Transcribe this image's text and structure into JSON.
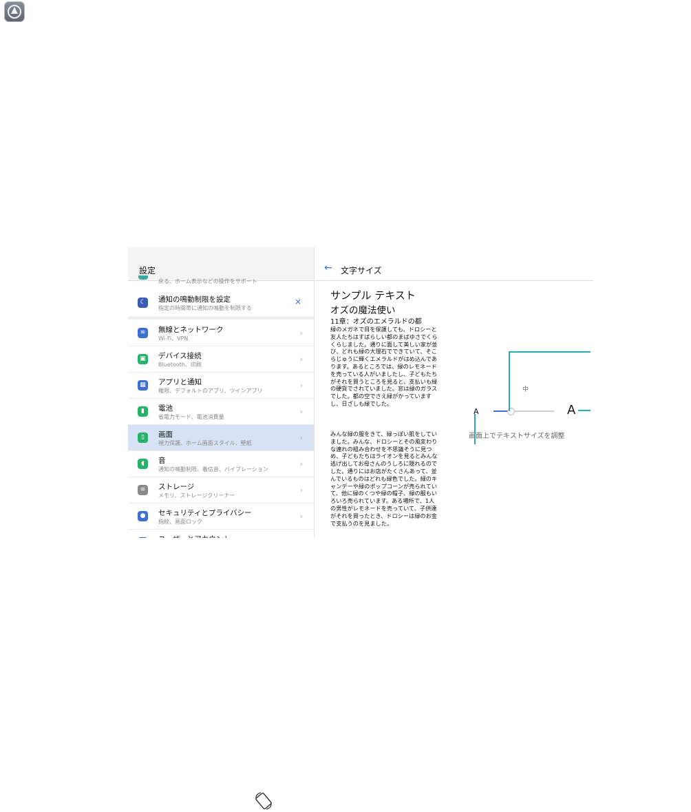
{
  "left_pane": {
    "title": "設定",
    "partial_top_subtitle": "戻る、ホーム表示などの操作をサポート",
    "dnd_suggestion": {
      "title": "通知の鳴動制限を設定",
      "subtitle": "指定の時間帯に通知の鳴動を制限する",
      "close": "×"
    },
    "items": [
      {
        "title": "無線とネットワーク",
        "subtitle": "Wi-Fi、VPN",
        "icon": "wifi-icon",
        "color": "#3b6fd1"
      },
      {
        "title": "デバイス接続",
        "subtitle": "Bluetooth、印刷",
        "icon": "device-connection-icon",
        "color": "#27b26a"
      },
      {
        "title": "アプリと通知",
        "subtitle": "権限、デフォルトのアプリ、ツインアプリ",
        "icon": "apps-icon",
        "color": "#3b6fd1"
      },
      {
        "title": "電池",
        "subtitle": "省電力モード、電池消費量",
        "icon": "battery-icon",
        "color": "#27b26a"
      },
      {
        "title": "画面",
        "subtitle": "視力保護、ホーム画面スタイル、壁紙",
        "icon": "display-icon",
        "color": "#27b26a",
        "active": true
      },
      {
        "title": "音",
        "subtitle": "通知の鳴動制限、着信音、バイブレーション",
        "icon": "sound-icon",
        "color": "#27b26a"
      },
      {
        "title": "ストレージ",
        "subtitle": "メモリ、ストレージクリーナー",
        "icon": "storage-icon",
        "color": "#8a8a8a"
      },
      {
        "title": "セキュリティとプライバシー",
        "subtitle": "指紋、画面ロック",
        "icon": "security-icon",
        "color": "#3b6fd1"
      },
      {
        "title": "ユーザーとアカウント",
        "subtitle": "",
        "icon": "user-icon",
        "color": "#3b6fd1"
      }
    ],
    "chevron": "›"
  },
  "right_pane": {
    "back": "←",
    "title": "文字サイズ",
    "sample_heading": "サンプル テキスト",
    "book_title": "オズの魔法使い",
    "chapter": "11章：オズのエメラルドの都",
    "paragraph1": "緑のメガネで目を保護しても、ドロシーと友人たちはすばらしい都のまばゆさでくらくらしました。通りに面して美しい家が並び、どれも緑の大理石でできていて、そこらじゅうに輝くエメラルドがはめ込んであります。あるところでは、緑のレモネードを売っている人がいましたし、子どもたちがそれを買うところを見ると、支払いも緑の硬貨でされていました。窓は緑のガラスでした。都の空でさえ緑がかっていますし、日ざしも緑でした。",
    "paragraph2": "みんな緑の服をきて、緑っぽい肌をしていました。みんな、ドロシーとその風変わりな連れの組み合わせを不思議そうに見つめ、子どもたちはライオンを見るとみんな逃げ出してお母さんのうしろに隠れるのでした。通りにはお店がたくさんあって、並んでいるものはどれも緑色でした。緑のキャンデーや緑のポップコーンが売られていて、他に緑のくつや緑の帽子、緑の服もいろいろ売られています。ある場所で、1人の男性がレモネードを売っていて、子供達がそれを買ったとき、ドロシーは緑のお金で支払うのを見ました。",
    "size_control": {
      "small_label": "A",
      "large_label": "A",
      "current_level": "中",
      "hint": "画面上でテキストサイズを調整",
      "position_fraction": 0.25
    }
  },
  "colors": {
    "accent": "#3b6fd1",
    "callout": "#2aa9b8",
    "active_row": "#d7e3f4"
  }
}
